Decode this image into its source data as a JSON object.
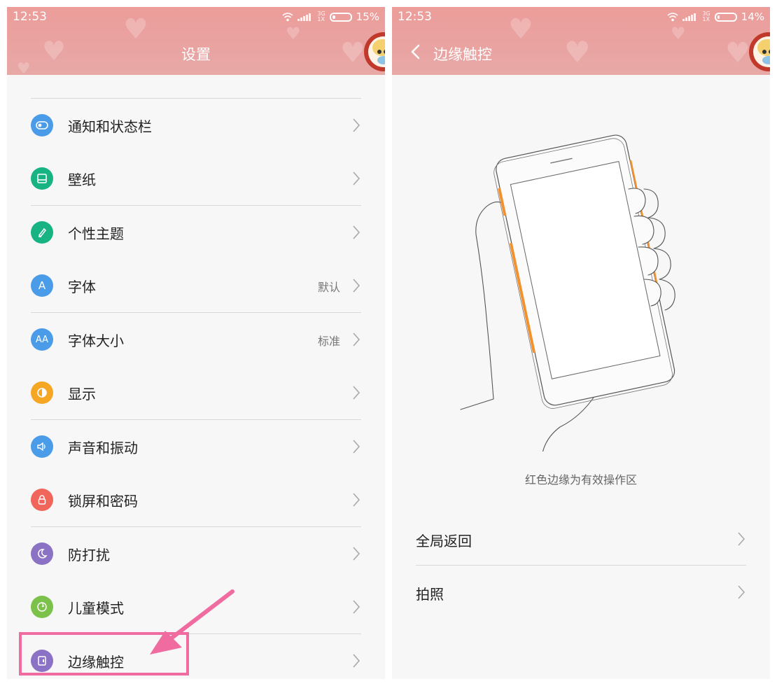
{
  "left": {
    "status": {
      "time": "12:53",
      "battery": "15%",
      "battery_level": 0.15,
      "net": "3G",
      "net_sub": "1X"
    },
    "title": "设置",
    "items": [
      {
        "icon": "notification-toggle-icon",
        "label": "通知和状态栏",
        "value": "",
        "color": "#4a9be8"
      },
      {
        "icon": "wallpaper-icon",
        "label": "壁纸",
        "value": "",
        "color": "#17b383"
      },
      {
        "icon": "theme-brush-icon",
        "label": "个性主题",
        "value": "",
        "color": "#17b383"
      },
      {
        "icon": "font-a-icon",
        "label": "字体",
        "value": "默认",
        "color": "#4a9be8"
      },
      {
        "icon": "font-size-icon",
        "label": "字体大小",
        "value": "标准",
        "color": "#4a9be8"
      },
      {
        "icon": "display-contrast-icon",
        "label": "显示",
        "value": "",
        "color": "#f5a623"
      },
      {
        "icon": "speaker-icon",
        "label": "声音和振动",
        "value": "",
        "color": "#4a9be8"
      },
      {
        "icon": "lock-icon",
        "label": "锁屏和密码",
        "value": "",
        "color": "#f0665a"
      },
      {
        "icon": "moon-icon",
        "label": "防打扰",
        "value": "",
        "color": "#8b72c4"
      },
      {
        "icon": "child-mode-icon",
        "label": "儿童模式",
        "value": "",
        "color": "#7cc24a"
      },
      {
        "icon": "edge-touch-icon",
        "label": "边缘触控",
        "value": "",
        "color": "#8b72c4"
      }
    ]
  },
  "right": {
    "status": {
      "time": "12:53",
      "battery": "14%",
      "battery_level": 0.14,
      "net": "3G",
      "net_sub": "1X"
    },
    "title": "边缘触控",
    "caption": "红色边缘为有效操作区",
    "items": [
      {
        "label": "全局返回"
      },
      {
        "label": "拍照"
      }
    ]
  },
  "colors": {
    "header": "#ec9d9a",
    "highlight": "#f06ca0",
    "edge_zone": "#f2912e"
  }
}
